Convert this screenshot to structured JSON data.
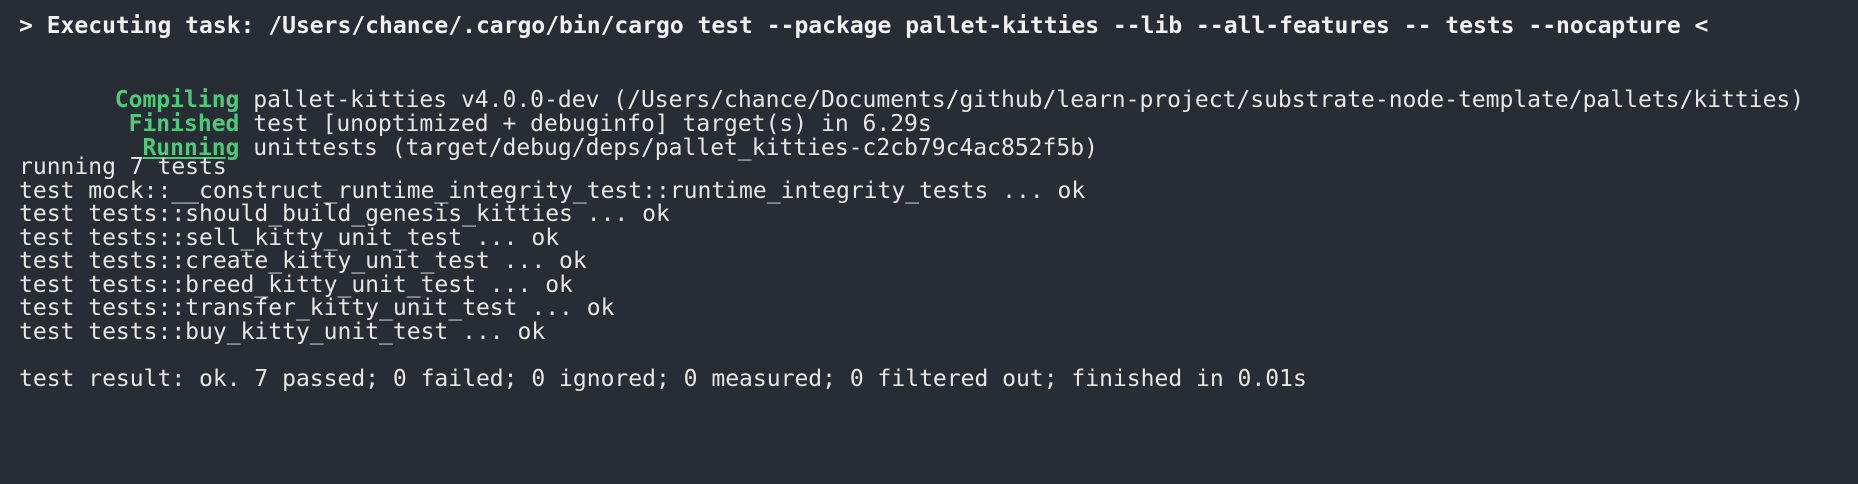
{
  "terminal": {
    "task_line": "> Executing task: /Users/chance/.cargo/bin/cargo test --package pallet-kitties --lib --all-features -- tests --nocapture <",
    "build": [
      {
        "status": "Compiling",
        "text": " pallet-kitties v4.0.0-dev (/Users/chance/Documents/github/learn-project/substrate-node-template/pallets/kitties)"
      },
      {
        "status": "Finished",
        "text": " test [unoptimized + debuginfo] target(s) in 6.29s"
      },
      {
        "status": "Running",
        "text": " unittests (target/debug/deps/pallet_kitties-c2cb79c4ac852f5b)"
      }
    ],
    "running": "running 7 tests",
    "tests": [
      "test mock::__construct_runtime_integrity_test::runtime_integrity_tests ... ok",
      "test tests::should_build_genesis_kitties ... ok",
      "test tests::sell_kitty_unit_test ... ok",
      "test tests::create_kitty_unit_test ... ok",
      "test tests::breed_kitty_unit_test ... ok",
      "test tests::transfer_kitty_unit_test ... ok",
      "test tests::buy_kitty_unit_test ... ok"
    ],
    "result": "test result: ok. 7 passed; 0 failed; 0 ignored; 0 measured; 0 filtered out; finished in 0.01s"
  },
  "colors": {
    "background": "#282c34",
    "foreground": "#e6e6e6",
    "status_green": "#4ec97a"
  }
}
